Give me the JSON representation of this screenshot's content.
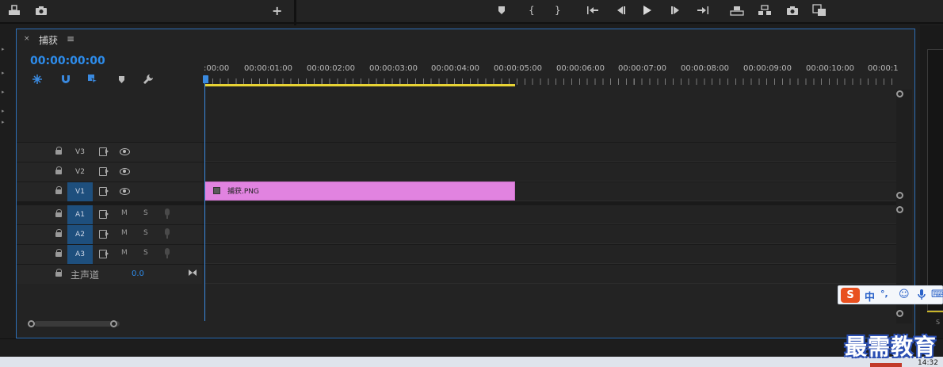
{
  "toolbar": {
    "left_icons": [
      "export-frame-icon",
      "camera-icon"
    ],
    "add_label": "+",
    "transport_icons": [
      {
        "name": "add-marker-icon",
        "glyph": "⬥"
      },
      {
        "name": "mark-in-icon",
        "glyph": "{"
      },
      {
        "name": "mark-out-icon",
        "glyph": "}"
      },
      {
        "name": "go-to-in-icon",
        "glyph": "|←"
      },
      {
        "name": "step-back-icon",
        "glyph": "◀|"
      },
      {
        "name": "play-icon",
        "glyph": "▶"
      },
      {
        "name": "step-forward-icon",
        "glyph": "|▶"
      },
      {
        "name": "go-to-out-icon",
        "glyph": "→|"
      },
      {
        "name": "lift-icon",
        "glyph": "▟▙"
      },
      {
        "name": "extract-icon",
        "glyph": "▙▟"
      },
      {
        "name": "export-frame-icon",
        "glyph": "◘"
      },
      {
        "name": "comparison-view-icon",
        "glyph": "▣"
      }
    ]
  },
  "panel": {
    "close": "×",
    "tab_title": "捕获",
    "menu": "≡",
    "timecode": "00:00:00:00"
  },
  "ruler": {
    "labels": [
      ":00:00",
      "00:00:01:00",
      "00:00:02:00",
      "00:00:03:00",
      "00:00:04:00",
      "00:00:05:00",
      "00:00:06:00",
      "00:00:07:00",
      "00:00:08:00",
      "00:00:09:00",
      "00:00:10:00",
      "00:00:1"
    ]
  },
  "tracks": {
    "video": [
      {
        "name": "V3",
        "active": false
      },
      {
        "name": "V2",
        "active": false
      },
      {
        "name": "V1",
        "active": true
      }
    ],
    "audio": [
      {
        "name": "A1",
        "mute": "M",
        "solo": "S"
      },
      {
        "name": "A2",
        "mute": "M",
        "solo": "S"
      },
      {
        "name": "A3",
        "mute": "M",
        "solo": "S"
      }
    ],
    "master": {
      "label": "主声道",
      "value": "0.0"
    }
  },
  "clip": {
    "label": "捕获.PNG",
    "color": "#e183e0"
  },
  "ime": {
    "logo": "S",
    "lang": "中",
    "punct": "°,",
    "emoji": "☺",
    "mic": "🎤",
    "keyboard": "⌨"
  },
  "right_edge": {
    "label": "S"
  },
  "taskbar": {
    "clock": "14:32"
  },
  "watermark": "最需教育",
  "colors": {
    "accent": "#2d8ceb",
    "workarea": "#e8d334",
    "clip": "#e183e0",
    "active_track": "#1e4f7d"
  }
}
